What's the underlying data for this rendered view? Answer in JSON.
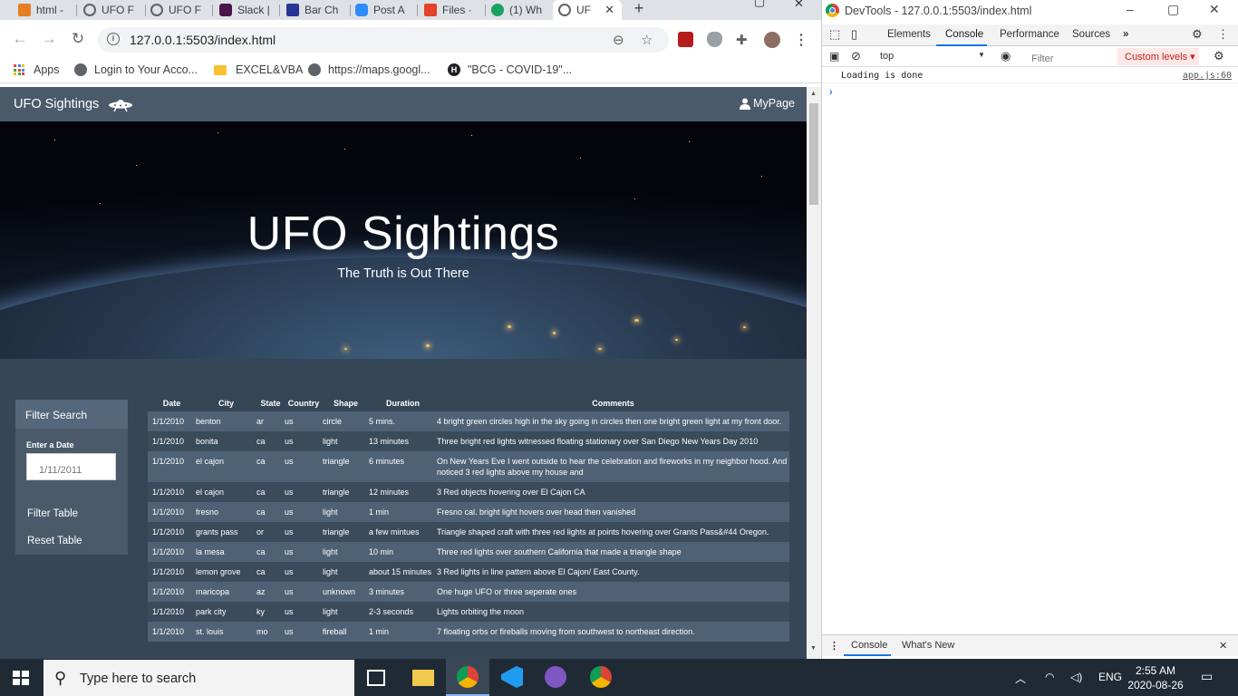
{
  "browser": {
    "tabs": [
      {
        "label": "html -",
        "color": "#e67e22"
      },
      {
        "label": "UFO F",
        "color": "#5f6368"
      },
      {
        "label": "UFO F",
        "color": "#5f6368"
      },
      {
        "label": "Slack |",
        "color": "#4a154b"
      },
      {
        "label": "Bar Ch",
        "color": "#283593"
      },
      {
        "label": "Post A",
        "color": "#2d8cff"
      },
      {
        "label": "Files ·",
        "color": "#e24329"
      },
      {
        "label": "(1) Wh",
        "color": "#1aa260"
      },
      {
        "label": "UF",
        "color": "#5f6368"
      }
    ],
    "url": "127.0.0.1:5503/index.html",
    "bookmarks": [
      {
        "label": "Apps"
      },
      {
        "label": "Login to Your Acco..."
      },
      {
        "label": "EXCEL&VBA"
      },
      {
        "label": "https://maps.googl..."
      },
      {
        "label": "\"BCG - COVID-19\"..."
      }
    ]
  },
  "site": {
    "brand": "UFO Sightings",
    "mypage": "MyPage",
    "hero_title": "UFO Sightings",
    "hero_subtitle": "The Truth is Out There",
    "filter": {
      "heading": "Filter Search",
      "date_label": "Enter a Date",
      "date_placeholder": "1/11/2011",
      "filter_button": "Filter Table",
      "reset_button": "Reset Table"
    },
    "table": {
      "headers": [
        "Date",
        "City",
        "State",
        "Country",
        "Shape",
        "Duration",
        "Comments"
      ],
      "rows": [
        [
          "1/1/2010",
          "benton",
          "ar",
          "us",
          "circle",
          "5 mins.",
          "4 bright green circles high in the sky going in circles then one bright green light at my front door."
        ],
        [
          "1/1/2010",
          "bonita",
          "ca",
          "us",
          "light",
          "13 minutes",
          "Three bright red lights witnessed floating stationary over San Diego New Years Day 2010"
        ],
        [
          "1/1/2010",
          "el cajon",
          "ca",
          "us",
          "triangle",
          "6 minutes",
          "On New Years Eve I went outside to hear the celebration and fireworks in my neighbor hood. And noticed 3 red lights above my house and"
        ],
        [
          "1/1/2010",
          "el cajon",
          "ca",
          "us",
          "triangle",
          "12 minutes",
          "3 Red objects hovering over El Cajon CA"
        ],
        [
          "1/1/2010",
          "fresno",
          "ca",
          "us",
          "light",
          "1 min",
          "Fresno cal. bright light hovers over head then vanished"
        ],
        [
          "1/1/2010",
          "grants pass",
          "or",
          "us",
          "triangle",
          "a few mintues",
          "Triangle shaped craft with three red lights at points hovering over Grants Pass&#44 Oregon."
        ],
        [
          "1/1/2010",
          "la mesa",
          "ca",
          "us",
          "light",
          "10 min",
          "Three red lights over southern California that made a triangle shape"
        ],
        [
          "1/1/2010",
          "lemon grove",
          "ca",
          "us",
          "light",
          "about 15 minutes",
          "3 Red lights in line pattern above El Cajon/ East County."
        ],
        [
          "1/1/2010",
          "maricopa",
          "az",
          "us",
          "unknown",
          "3 minutes",
          "One huge UFO or three seperate ones"
        ],
        [
          "1/1/2010",
          "park city",
          "ky",
          "us",
          "light",
          "2-3 seconds",
          "Lights orbiting the moon"
        ],
        [
          "1/1/2010",
          "st. louis",
          "mo",
          "us",
          "fireball",
          "1 min",
          "7 floating orbs or fireballs moving from southwest to northeast direction."
        ]
      ]
    }
  },
  "devtools": {
    "title": "DevTools - 127.0.0.1:5503/index.html",
    "tabs": [
      "Elements",
      "Console",
      "Performance",
      "Sources"
    ],
    "active_tab": "Console",
    "context": "top",
    "filter_placeholder": "Filter",
    "levels": "Custom levels",
    "messages": [
      {
        "text": "Loading is done",
        "source": "app.js:60"
      }
    ],
    "drawer_tabs": [
      "Console",
      "What's New"
    ]
  },
  "taskbar": {
    "search_placeholder": "Type here to search",
    "language": "ENG",
    "time": "2:55 AM",
    "date": "2020-08-26"
  }
}
